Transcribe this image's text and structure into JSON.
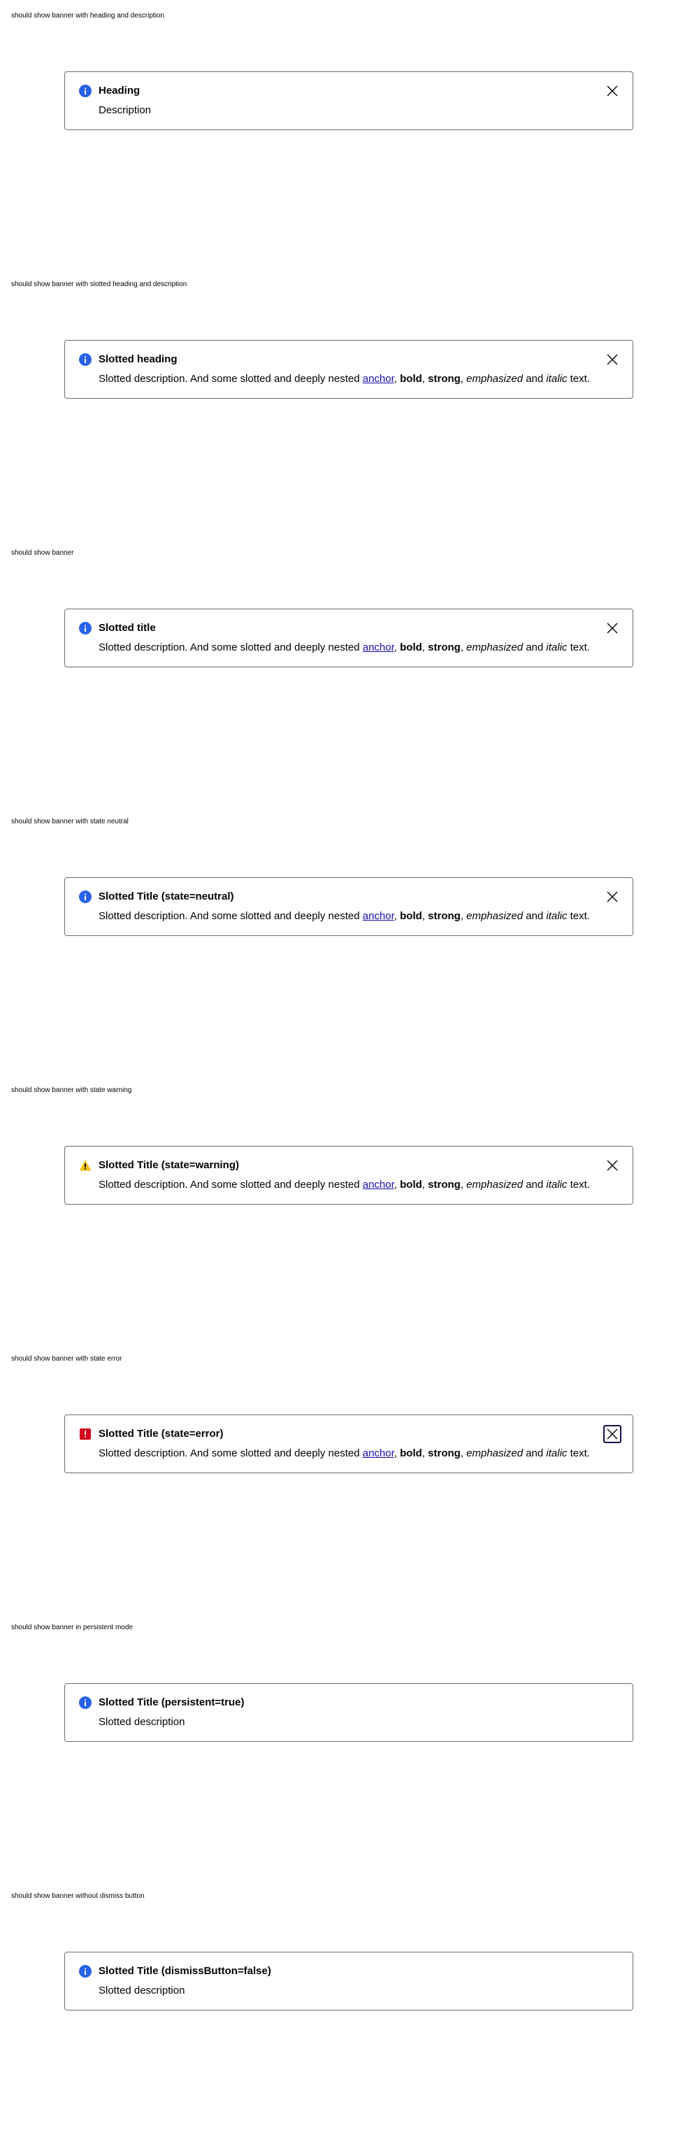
{
  "colors": {
    "info": "#2762ec",
    "warning": "#f1c219",
    "error": "#d5001c",
    "text": "#010205",
    "border": "#6b6d70",
    "link": "#1a0dab",
    "focus": "#1a0a4a"
  },
  "sections": [
    {
      "label": "should show banner with heading and description",
      "heading": "Heading",
      "description": "Description",
      "icon": "info-icon"
    },
    {
      "label": "should show banner with slotted heading and description",
      "heading": "Slotted heading",
      "description_parts": {
        "prefix": "Slotted description. And some slotted and deeply nested ",
        "anchor": "anchor",
        "sep1": ", ",
        "bold": "bold",
        "sep2": ", ",
        "strong": "strong",
        "sep3": ", ",
        "emphasized": "emphasized",
        "sep4": " and ",
        "italic": "italic",
        "suffix": " text."
      },
      "icon": "info-icon"
    },
    {
      "label": "should show banner",
      "heading": "Slotted title",
      "description_parts": {
        "prefix": "Slotted description. And some slotted and deeply nested ",
        "anchor": "anchor",
        "sep1": ", ",
        "bold": "bold",
        "sep2": ", ",
        "strong": "strong",
        "sep3": ", ",
        "emphasized": "emphasized",
        "sep4": " and ",
        "italic": "italic",
        "suffix": " text."
      },
      "icon": "info-icon"
    },
    {
      "label": "should show banner with state neutral",
      "heading": "Slotted Title (state=neutral)",
      "description_parts": {
        "prefix": "Slotted description. And some slotted and deeply nested ",
        "anchor": "anchor",
        "sep1": ", ",
        "bold": "bold",
        "sep2": ", ",
        "strong": "strong",
        "sep3": ", ",
        "emphasized": "emphasized",
        "sep4": " and ",
        "italic": "italic",
        "suffix": " text."
      },
      "icon": "info-icon"
    },
    {
      "label": "should show banner with state warning",
      "heading": "Slotted Title (state=warning)",
      "description_parts": {
        "prefix": "Slotted description. And some slotted and deeply nested ",
        "anchor": "anchor",
        "sep1": ", ",
        "bold": "bold",
        "sep2": ", ",
        "strong": "strong",
        "sep3": ", ",
        "emphasized": "emphasized",
        "sep4": " and ",
        "italic": "italic",
        "suffix": " text."
      },
      "icon": "warning-icon"
    },
    {
      "label": "should show banner with state error",
      "heading": "Slotted Title (state=error)",
      "description_parts": {
        "prefix": "Slotted description. And some slotted and deeply nested ",
        "anchor": "anchor",
        "sep1": ", ",
        "bold": "bold",
        "sep2": ", ",
        "strong": "strong",
        "sep3": ", ",
        "emphasized": "emphasized",
        "sep4": " and ",
        "italic": "italic",
        "suffix": " text."
      },
      "icon": "error-icon"
    },
    {
      "label": "should show banner in persistent mode",
      "heading": "Slotted Title (persistent=true)",
      "description": "Slotted description",
      "icon": "info-icon"
    },
    {
      "label": "should show banner without dismiss button",
      "heading": "Slotted Title (dismissButton=false)",
      "description": "Slotted description",
      "icon": "info-icon"
    }
  ]
}
